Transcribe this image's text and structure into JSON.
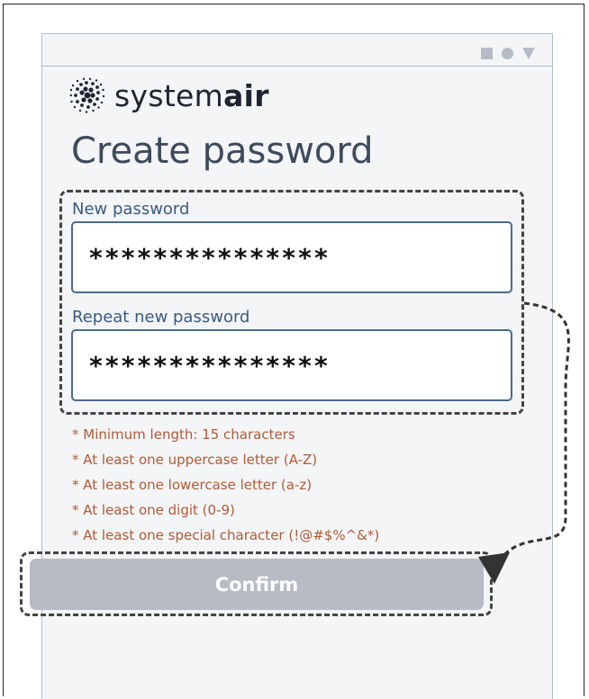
{
  "app": {
    "logo_text_regular": "system",
    "logo_text_bold": "air"
  },
  "page": {
    "title": "Create password"
  },
  "form": {
    "new_password": {
      "label": "New password",
      "value": "***************"
    },
    "repeat_password": {
      "label": "Repeat new password",
      "value": "***************"
    }
  },
  "requirements": [
    "* Minimum length: 15 characters",
    "* At least one uppercase letter (A-Z)",
    "* At least one lowercase letter (a-z)",
    "* At least one digit (0-9)",
    "* At least one special character (!@#$%^&*)"
  ],
  "actions": {
    "confirm_label": "Confirm",
    "confirm_state": "disabled"
  },
  "status_bar": {
    "icons": [
      "square-icon",
      "circle-icon",
      "triangle-down-icon"
    ]
  },
  "colors": {
    "label_blue": "#3c5a82",
    "field_border": "#4b6990",
    "requirement_text": "#b15a36",
    "disabled_button": "#b6bbc4",
    "title": "#3d4a5c"
  }
}
